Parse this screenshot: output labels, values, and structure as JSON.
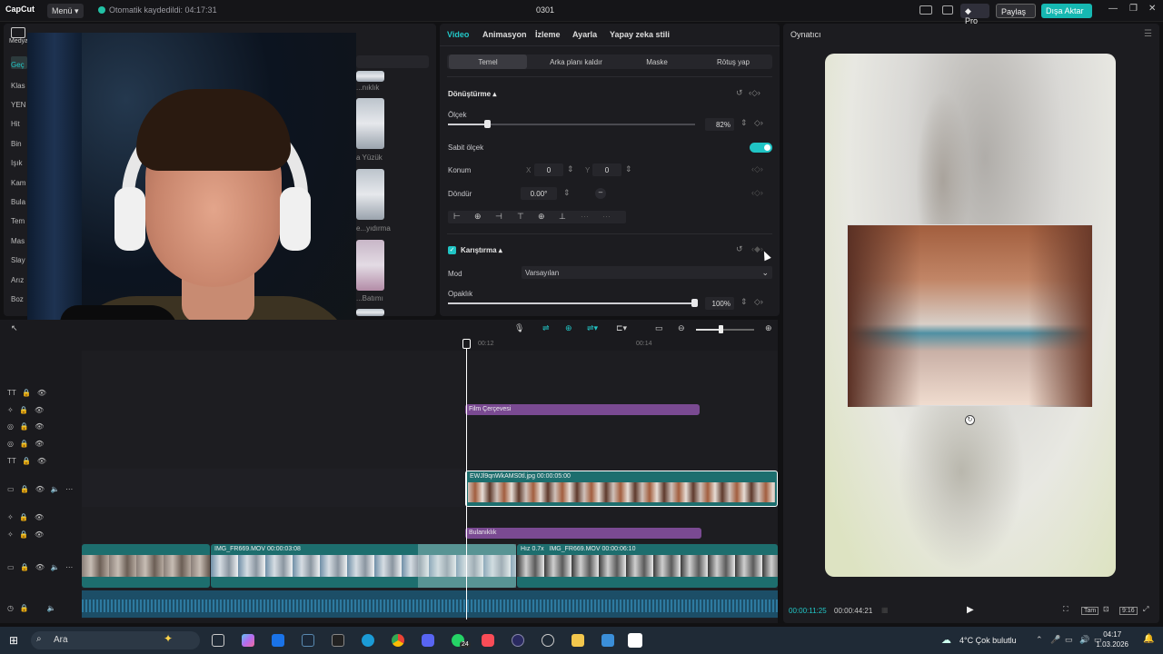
{
  "titlebar": {
    "logo": "CapCut",
    "menu_label": "Menü",
    "autosave": "Otomatik kaydedildi: 04:17:31",
    "project_title": "0301",
    "pro_label": "Pro",
    "share_label": "Paylaş",
    "export_label": "Dışa Aktar"
  },
  "left_panel": {
    "media_label": "Medya",
    "categories": [
      "Geç",
      "Klas",
      "YEN",
      "Hit",
      "Bin",
      "Işık",
      "Kam",
      "Bula",
      "Tem",
      "Mas",
      "Slay",
      "Arız",
      "Boz"
    ],
    "thumb_labels": [
      "...nıklık",
      "a Yüzük",
      "e...yıdırma",
      "...Batımı"
    ]
  },
  "properties": {
    "tabs": [
      "Video",
      "Animasyon",
      "İzleme",
      "Ayarla",
      "Yapay zeka stili"
    ],
    "active_tab": "Video",
    "subtabs": [
      "Temel",
      "Arka planı kaldır",
      "Maske",
      "Rötuş yap"
    ],
    "transform": {
      "title": "Dönüştürme",
      "scale_label": "Ölçek",
      "scale_value": "82%",
      "scale_fraction": 0.16,
      "fixed_scale_label": "Sabit ölçek",
      "position_label": "Konum",
      "x_label": "X",
      "x_value": "0",
      "y_label": "Y",
      "y_value": "0",
      "rotate_label": "Döndür",
      "rotate_value": "0.00°"
    },
    "blend": {
      "title": "Karıştırma",
      "mode_label": "Mod",
      "mode_value": "Varsayılan",
      "opacity_label": "Opaklık",
      "opacity_value": "100%",
      "opacity_fraction": 1.0
    }
  },
  "player": {
    "title": "Oynatıcı",
    "current_time": "00:00:11:25",
    "total_time": "00:00:44:21",
    "full_label": "Tam",
    "ratio_label": "9:16"
  },
  "timeline": {
    "ruler_marks": [
      "00:12",
      "00:14"
    ],
    "clips": {
      "film_frame": "Film Çerçevesi",
      "image_clip": "EWJl9qnWkAMS0tl.jpg  00:00:05:00",
      "blur": "Bulanıklık",
      "main1": "IMG_FR669.MOV  00:00:03:08",
      "main2_speed": "Hız 0.7x",
      "main2": "IMG_FR669.MOV  00:00:06:10"
    }
  },
  "taskbar": {
    "search_placeholder": "Ara",
    "weather": "4°C  Çok bulutlu",
    "time": "04:17",
    "date": "1.03.2026",
    "badge": "24"
  },
  "colors": {
    "accent": "#22c7c7",
    "export": "#16b8b2",
    "effect_clip": "#7a4a92",
    "media_clip": "#1d6e6e"
  }
}
